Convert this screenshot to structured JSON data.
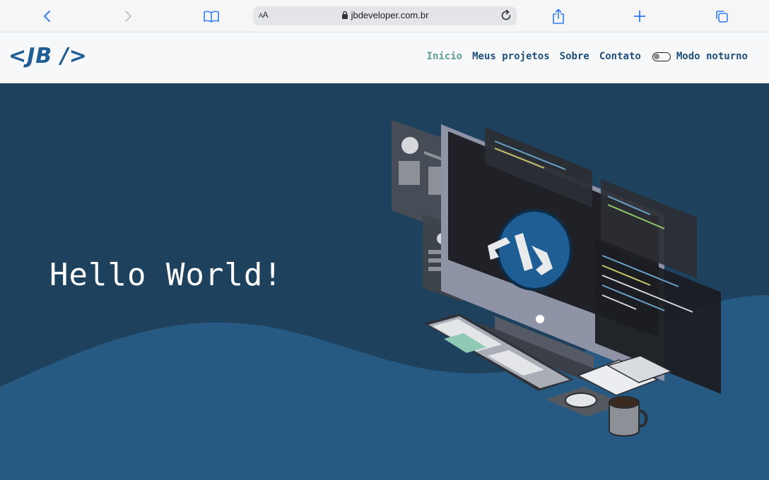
{
  "browser": {
    "url": "jbdeveloper.com.br",
    "aa_label_small": "A",
    "aa_label_large": "A",
    "icons": [
      "chevron-left-icon",
      "chevron-right-icon",
      "book-icon",
      "lock-icon",
      "reload-icon",
      "share-icon",
      "plus-icon",
      "tabs-icon"
    ]
  },
  "header": {
    "logo": "<JB />",
    "nav": [
      {
        "label": "Início",
        "active": true
      },
      {
        "label": "Meus projetos",
        "active": false
      },
      {
        "label": "Sobre",
        "active": false
      },
      {
        "label": "Contato",
        "active": false
      }
    ],
    "dark_mode_label": "Modo noturno",
    "dark_mode_on": false
  },
  "hero": {
    "title": "Hello World!"
  },
  "colors": {
    "accent": "#1f5d95",
    "nav_text": "#1f4f7a",
    "nav_active": "#5e9e93",
    "hero_bg": "#1e415e",
    "hero_wave": "#275a82",
    "header_bg": "#f7f8fa"
  }
}
